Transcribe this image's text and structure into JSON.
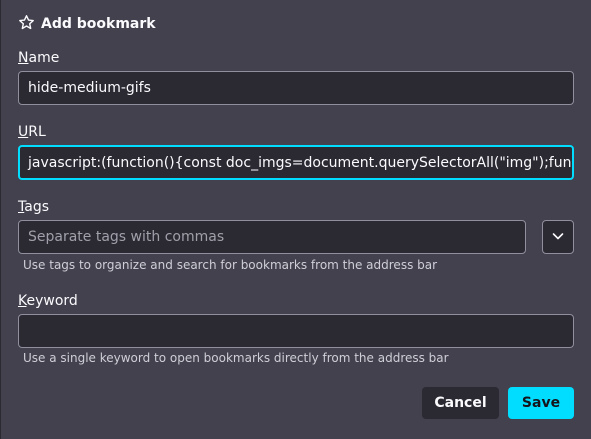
{
  "dialog": {
    "title": "Add bookmark",
    "title_icon": "star-outline-icon"
  },
  "name": {
    "label_accesskey": "N",
    "label_rest": "ame",
    "value": "hide-medium-gifs"
  },
  "url": {
    "label_accesskey": "U",
    "label_rest": "RL",
    "value": "javascript:(function(){const doc_imgs=document.querySelectorAll(\"img\");function"
  },
  "tags": {
    "label_accesskey": "T",
    "label_rest": "ags",
    "placeholder": "Separate tags with commas",
    "hint": "Use tags to organize and search for bookmarks from the address bar",
    "dropdown_icon": "chevron-down-icon"
  },
  "keyword": {
    "label_accesskey": "K",
    "label_rest": "eyword",
    "value": "",
    "hint": "Use a single keyword to open bookmarks directly from the address bar"
  },
  "buttons": {
    "cancel_label": "Cancel",
    "save_label": "Save"
  },
  "colors": {
    "background": "#42414d",
    "field_bg": "#2b2a33",
    "accent": "#00ddff"
  }
}
